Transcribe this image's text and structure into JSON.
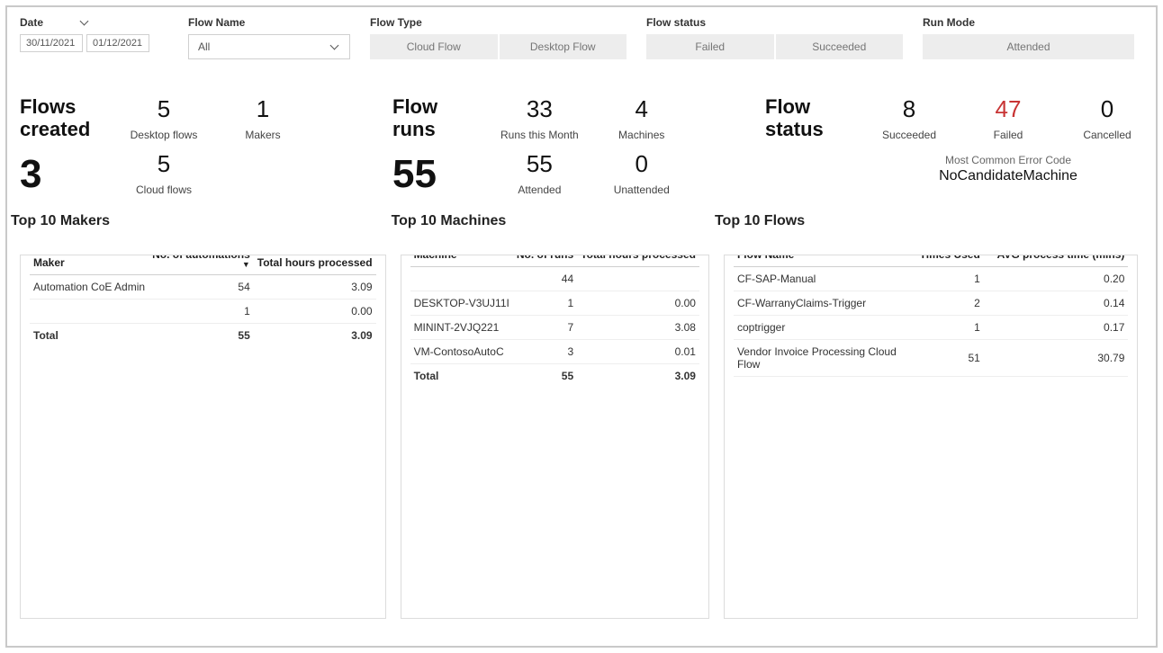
{
  "filters": {
    "date_label": "Date",
    "date_from": "30/11/2021",
    "date_to": "01/12/2021",
    "flow_name_label": "Flow Name",
    "flow_name_selected": "All",
    "flow_type_label": "Flow Type",
    "flow_type_options": [
      "Cloud Flow",
      "Desktop Flow"
    ],
    "flow_status_label": "Flow status",
    "flow_status_options": [
      "Failed",
      "Succeeded"
    ],
    "run_mode_label": "Run Mode",
    "run_mode_options": [
      "Attended"
    ]
  },
  "cards": {
    "flows_created": {
      "title": "Flows created",
      "value": "3",
      "desktop_flows": {
        "val": "5",
        "label": "Desktop flows"
      },
      "cloud_flows": {
        "val": "5",
        "label": "Cloud flows"
      },
      "makers": {
        "val": "1",
        "label": "Makers"
      }
    },
    "flow_runs": {
      "title": "Flow runs",
      "value": "55",
      "runs_month": {
        "val": "33",
        "label": "Runs this Month"
      },
      "attended": {
        "val": "55",
        "label": "Attended"
      },
      "machines": {
        "val": "4",
        "label": "Machines"
      },
      "unattended": {
        "val": "0",
        "label": "Unattended"
      }
    },
    "flow_status": {
      "title": "Flow status",
      "succeeded": {
        "val": "8",
        "label": "Succeeded"
      },
      "failed": {
        "val": "47",
        "label": "Failed"
      },
      "cancelled": {
        "val": "0",
        "label": "Cancelled"
      },
      "error_code_label": "Most Common Error Code",
      "error_code_value": "NoCandidateMachine"
    }
  },
  "tables": {
    "makers": {
      "title": "Top 10 Makers",
      "cols": [
        "Maker",
        "No. of automations",
        "Total hours processed"
      ],
      "rows": [
        {
          "c0": "Automation CoE Admin",
          "c1": "54",
          "c2": "3.09"
        },
        {
          "c0": "",
          "c1": "1",
          "c2": "0.00"
        }
      ],
      "total": {
        "c0": "Total",
        "c1": "55",
        "c2": "3.09"
      }
    },
    "machines": {
      "title": "Top 10 Machines",
      "cols": [
        "Machine",
        "No. of runs",
        "Total hours processed"
      ],
      "rows": [
        {
          "c0": "",
          "c1": "44",
          "c2": ""
        },
        {
          "c0": "DESKTOP-V3UJ11I",
          "c1": "1",
          "c2": "0.00"
        },
        {
          "c0": "MININT-2VJQ221",
          "c1": "7",
          "c2": "3.08"
        },
        {
          "c0": "VM-ContosoAutoC",
          "c1": "3",
          "c2": "0.01"
        }
      ],
      "total": {
        "c0": "Total",
        "c1": "55",
        "c2": "3.09"
      }
    },
    "flows": {
      "title": "Top 10 Flows",
      "cols": [
        "Flow Name",
        "Times Used",
        "AVG process time (mins)"
      ],
      "rows": [
        {
          "c0": "CF-SAP-Manual",
          "c1": "1",
          "c2": "0.20"
        },
        {
          "c0": "CF-WarranyClaims-Trigger",
          "c1": "2",
          "c2": "0.14"
        },
        {
          "c0": "coptrigger",
          "c1": "1",
          "c2": "0.17"
        },
        {
          "c0": "Vendor Invoice Processing Cloud Flow",
          "c1": "51",
          "c2": "30.79"
        }
      ]
    }
  }
}
